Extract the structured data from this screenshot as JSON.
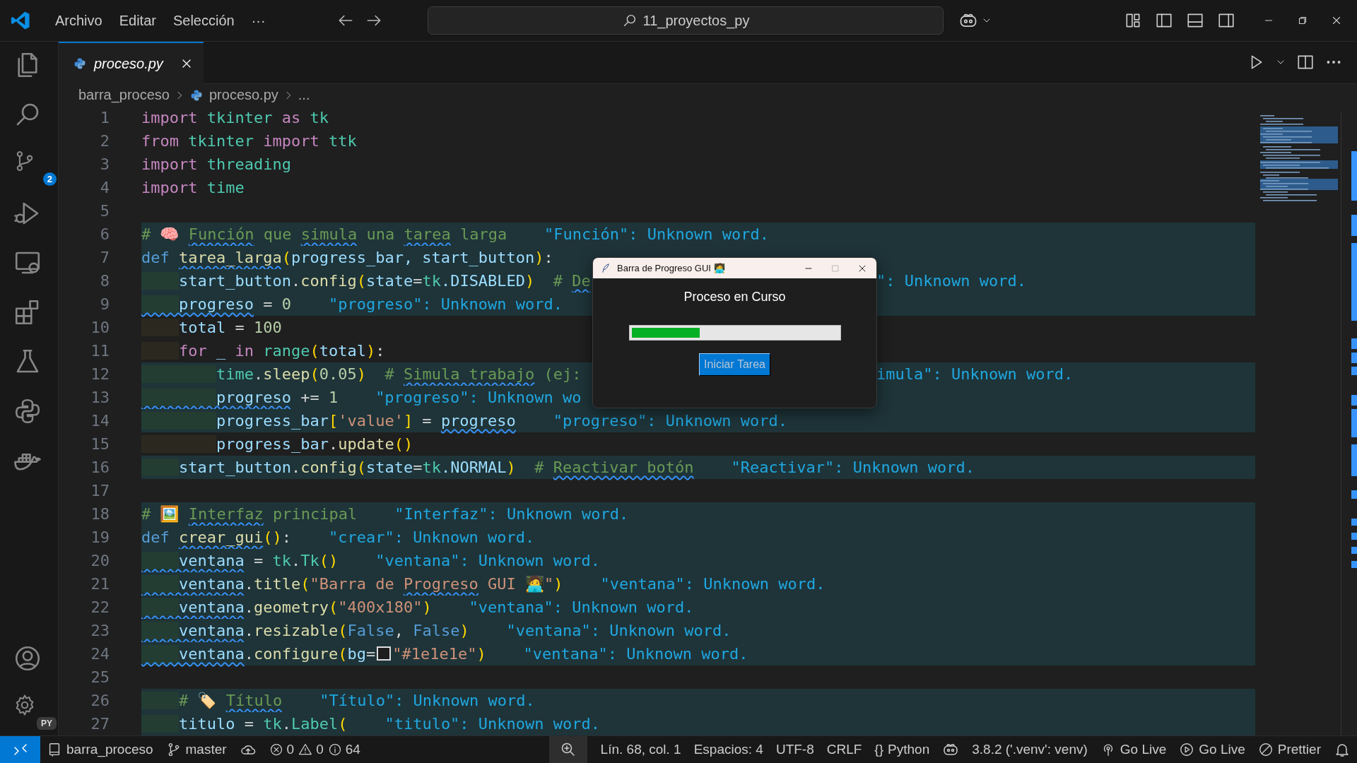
{
  "title_bar": {
    "menus": [
      "Archivo",
      "Editar",
      "Selección",
      "···"
    ],
    "search": "11_proyectos_py"
  },
  "activity_bar": {
    "items": [
      {
        "kind": "files"
      },
      {
        "kind": "search"
      },
      {
        "kind": "source-control",
        "badge": "2"
      },
      {
        "kind": "run-debug"
      },
      {
        "kind": "remote"
      },
      {
        "kind": "extensions"
      },
      {
        "kind": "testing"
      },
      {
        "kind": "python"
      },
      {
        "kind": "docker"
      }
    ],
    "bottom_items": [
      {
        "kind": "account"
      },
      {
        "kind": "settings",
        "badge": "PY"
      }
    ]
  },
  "editor": {
    "tabs": [
      {
        "label": "proceso.py",
        "selected": true
      }
    ],
    "breadcrumb": [
      {
        "kind": "folder",
        "text": "barra_proceso"
      },
      {
        "kind": "file",
        "text": "proceso.py"
      },
      {
        "kind": "more",
        "text": "..."
      }
    ],
    "lines": [
      {
        "number": "1",
        "highlighted": false,
        "code": [
          {
            "text": "import ",
            "kind": "kw",
            "misspelled": false
          },
          {
            "text": "tkinter ",
            "kind": "mod",
            "misspelled": false
          },
          {
            "text": "as ",
            "kind": "kw",
            "misspelled": false
          },
          {
            "text": "tk",
            "kind": "mod",
            "misspelled": false
          }
        ]
      },
      {
        "number": "2",
        "highlighted": false,
        "code": [
          {
            "text": "from ",
            "kind": "kw",
            "misspelled": false
          },
          {
            "text": "tkinter ",
            "kind": "mod",
            "misspelled": false
          },
          {
            "text": "import ",
            "kind": "kw",
            "misspelled": false
          },
          {
            "text": "ttk",
            "kind": "mod",
            "misspelled": false
          }
        ]
      },
      {
        "number": "3",
        "highlighted": false,
        "code": [
          {
            "text": "import ",
            "kind": "kw",
            "misspelled": false
          },
          {
            "text": "threading",
            "kind": "mod",
            "misspelled": false
          }
        ]
      },
      {
        "number": "4",
        "highlighted": false,
        "code": [
          {
            "text": "import ",
            "kind": "kw",
            "misspelled": false
          },
          {
            "text": "time",
            "kind": "mod",
            "misspelled": false
          }
        ]
      },
      {
        "number": "5",
        "highlighted": false
      },
      {
        "number": "6",
        "highlighted": true,
        "code": [
          {
            "text": "# 🧠 ",
            "kind": "cmt",
            "misspelled": false
          },
          {
            "text": "Función",
            "kind": "cmt",
            "misspelled": true
          },
          {
            "text": " que ",
            "kind": "cmt",
            "misspelled": false
          },
          {
            "text": "simula",
            "kind": "cmt",
            "misspelled": true
          },
          {
            "text": " una ",
            "kind": "cmt",
            "misspelled": false
          },
          {
            "text": "tarea",
            "kind": "cmt",
            "misspelled": true
          },
          {
            "text": " larga",
            "kind": "cmt",
            "misspelled": false
          }
        ],
        "diagnostic": "\"Función\": Unknown word."
      },
      {
        "number": "7",
        "highlighted": true,
        "code": [
          {
            "text": "def ",
            "kind": "kw2",
            "misspelled": false
          },
          {
            "text": "tarea_larga",
            "kind": "fn",
            "misspelled": true
          },
          {
            "text": "(",
            "kind": "br",
            "misspelled": false
          },
          {
            "text": "progress_bar, start_button",
            "kind": "var",
            "misspelled": false
          },
          {
            "text": ")",
            "kind": "br",
            "misspelled": false
          },
          {
            "text": ":",
            "kind": "p",
            "misspelled": false
          }
        ]
      },
      {
        "number": "8",
        "highlighted": true,
        "code": [
          {
            "text": "    start_button",
            "kind": "var",
            "misspelled": false
          },
          {
            "text": ".",
            "kind": "p",
            "misspelled": false
          },
          {
            "text": "config",
            "kind": "fn",
            "misspelled": false
          },
          {
            "text": "(",
            "kind": "br",
            "misspelled": false
          },
          {
            "text": "state",
            "kind": "var",
            "misspelled": false
          },
          {
            "text": "=",
            "kind": "p",
            "misspelled": false
          },
          {
            "text": "tk",
            "kind": "mod",
            "misspelled": false
          },
          {
            "text": ".DISABLED",
            "kind": "var",
            "misspelled": false
          },
          {
            "text": ")",
            "kind": "br",
            "misspelled": false
          },
          {
            "text": "  # ",
            "kind": "cmt",
            "misspelled": false
          },
          {
            "text": "De",
            "kind": "cmt",
            "misspelled": true
          }
        ],
        "right": "\": Unknown word."
      },
      {
        "number": "9",
        "highlighted": true,
        "code": [
          {
            "text": "    progreso",
            "kind": "var",
            "misspelled": true
          },
          {
            "text": " = ",
            "kind": "p",
            "misspelled": false
          },
          {
            "text": "0",
            "kind": "num",
            "misspelled": false
          }
        ],
        "diagnostic": "\"progreso\": Unknown word."
      },
      {
        "number": "10",
        "highlighted": false,
        "code": [
          {
            "text": "    total",
            "kind": "var",
            "misspelled": false
          },
          {
            "text": " = ",
            "kind": "p",
            "misspelled": false
          },
          {
            "text": "100",
            "kind": "num",
            "misspelled": false
          }
        ]
      },
      {
        "number": "11",
        "highlighted": false,
        "code": [
          {
            "text": "    for ",
            "kind": "kw",
            "misspelled": false
          },
          {
            "text": "_ ",
            "kind": "var",
            "misspelled": false
          },
          {
            "text": "in ",
            "kind": "kw",
            "misspelled": false
          },
          {
            "text": "range",
            "kind": "mod",
            "misspelled": false
          },
          {
            "text": "(",
            "kind": "br",
            "misspelled": false
          },
          {
            "text": "total",
            "kind": "var",
            "misspelled": false
          },
          {
            "text": ")",
            "kind": "br",
            "misspelled": false
          },
          {
            "text": ":",
            "kind": "p",
            "misspelled": false
          }
        ]
      },
      {
        "number": "12",
        "highlighted": true,
        "code": [
          {
            "text": "        time",
            "kind": "mod",
            "misspelled": false
          },
          {
            "text": ".",
            "kind": "p",
            "misspelled": false
          },
          {
            "text": "sleep",
            "kind": "fn",
            "misspelled": false
          },
          {
            "text": "(",
            "kind": "br",
            "misspelled": false
          },
          {
            "text": "0.05",
            "kind": "num",
            "misspelled": false
          },
          {
            "text": ")",
            "kind": "br",
            "misspelled": false
          },
          {
            "text": "  # ",
            "kind": "cmt",
            "misspelled": false
          },
          {
            "text": "Simula trabajo",
            "kind": "cmt",
            "misspelled": true
          },
          {
            "text": " (ej:",
            "kind": "cmt",
            "misspelled": false
          }
        ],
        "right": "imula\": Unknown word."
      },
      {
        "number": "13",
        "highlighted": true,
        "code": [
          {
            "text": "        progreso",
            "kind": "var",
            "misspelled": true
          },
          {
            "text": " += ",
            "kind": "p",
            "misspelled": false
          },
          {
            "text": "1",
            "kind": "num",
            "misspelled": false
          }
        ],
        "diagnostic": "\"progreso\": Unknown wo"
      },
      {
        "number": "14",
        "highlighted": true,
        "code": [
          {
            "text": "        progress_bar",
            "kind": "var",
            "misspelled": false
          },
          {
            "text": "[",
            "kind": "br",
            "misspelled": false
          },
          {
            "text": "'value'",
            "kind": "str",
            "misspelled": false
          },
          {
            "text": "]",
            "kind": "br",
            "misspelled": false
          },
          {
            "text": " = ",
            "kind": "p",
            "misspelled": false
          },
          {
            "text": "progreso",
            "kind": "var",
            "misspelled": true
          }
        ],
        "diagnostic": "\"progreso\": Unknown word."
      },
      {
        "number": "15",
        "highlighted": false,
        "code": [
          {
            "text": "        progress_bar",
            "kind": "var",
            "misspelled": false
          },
          {
            "text": ".",
            "kind": "p",
            "misspelled": false
          },
          {
            "text": "update",
            "kind": "fn",
            "misspelled": false
          },
          {
            "text": "()",
            "kind": "br",
            "misspelled": false
          }
        ]
      },
      {
        "number": "16",
        "highlighted": true,
        "code": [
          {
            "text": "    start_button",
            "kind": "var",
            "misspelled": false
          },
          {
            "text": ".",
            "kind": "p",
            "misspelled": false
          },
          {
            "text": "config",
            "kind": "fn",
            "misspelled": false
          },
          {
            "text": "(",
            "kind": "br",
            "misspelled": false
          },
          {
            "text": "state",
            "kind": "var",
            "misspelled": false
          },
          {
            "text": "=",
            "kind": "p",
            "misspelled": false
          },
          {
            "text": "tk",
            "kind": "mod",
            "misspelled": false
          },
          {
            "text": ".NORMAL",
            "kind": "var",
            "misspelled": false
          },
          {
            "text": ")",
            "kind": "br",
            "misspelled": false
          },
          {
            "text": "  # ",
            "kind": "cmt",
            "misspelled": false
          },
          {
            "text": "Reactivar botón",
            "kind": "cmt",
            "misspelled": true
          }
        ],
        "diagnostic": "\"Reactivar\": Unknown word."
      },
      {
        "number": "17",
        "highlighted": false
      },
      {
        "number": "18",
        "highlighted": true,
        "code": [
          {
            "text": "# 🖼️ ",
            "kind": "cmt",
            "misspelled": false
          },
          {
            "text": "Interfaz",
            "kind": "cmt",
            "misspelled": true
          },
          {
            "text": " principal",
            "kind": "cmt",
            "misspelled": false
          }
        ],
        "diagnostic": "\"Interfaz\": Unknown word."
      },
      {
        "number": "19",
        "highlighted": true,
        "code": [
          {
            "text": "def ",
            "kind": "kw2",
            "misspelled": false
          },
          {
            "text": "crear_gui",
            "kind": "fn",
            "misspelled": true
          },
          {
            "text": "()",
            "kind": "br",
            "misspelled": false
          },
          {
            "text": ":",
            "kind": "p",
            "misspelled": false
          }
        ],
        "diagnostic": "\"crear\": Unknown word."
      },
      {
        "number": "20",
        "highlighted": true,
        "code": [
          {
            "text": "    ventana",
            "kind": "var",
            "misspelled": true
          },
          {
            "text": " = ",
            "kind": "p",
            "misspelled": false
          },
          {
            "text": "tk",
            "kind": "mod",
            "misspelled": false
          },
          {
            "text": ".",
            "kind": "p",
            "misspelled": false
          },
          {
            "text": "Tk",
            "kind": "mod",
            "misspelled": false
          },
          {
            "text": "()",
            "kind": "br",
            "misspelled": false
          }
        ],
        "diagnostic": "\"ventana\": Unknown word."
      },
      {
        "number": "21",
        "highlighted": true,
        "code": [
          {
            "text": "    ventana",
            "kind": "var",
            "misspelled": true
          },
          {
            "text": ".",
            "kind": "p",
            "misspelled": false
          },
          {
            "text": "title",
            "kind": "fn",
            "misspelled": false
          },
          {
            "text": "(",
            "kind": "br",
            "misspelled": false
          },
          {
            "text": "\"Barra de ",
            "kind": "str",
            "misspelled": false
          },
          {
            "text": "Progreso",
            "kind": "str",
            "misspelled": true
          },
          {
            "text": " GUI 🧑‍💻\"",
            "kind": "str",
            "misspelled": false
          },
          {
            "text": ")",
            "kind": "br",
            "misspelled": false
          }
        ],
        "diagnostic": "\"ventana\": Unknown word."
      },
      {
        "number": "22",
        "highlighted": true,
        "code": [
          {
            "text": "    ventana",
            "kind": "var",
            "misspelled": true
          },
          {
            "text": ".",
            "kind": "p",
            "misspelled": false
          },
          {
            "text": "geometry",
            "kind": "fn",
            "misspelled": false
          },
          {
            "text": "(",
            "kind": "br",
            "misspelled": false
          },
          {
            "text": "\"400x180\"",
            "kind": "str",
            "misspelled": false
          },
          {
            "text": ")",
            "kind": "br",
            "misspelled": false
          }
        ],
        "diagnostic": "\"ventana\": Unknown word."
      },
      {
        "number": "23",
        "highlighted": true,
        "code": [
          {
            "text": "    ventana",
            "kind": "var",
            "misspelled": true
          },
          {
            "text": ".",
            "kind": "p",
            "misspelled": false
          },
          {
            "text": "resizable",
            "kind": "fn",
            "misspelled": false
          },
          {
            "text": "(",
            "kind": "br",
            "misspelled": false
          },
          {
            "text": "False",
            "kind": "kw2",
            "misspelled": false
          },
          {
            "text": ", ",
            "kind": "p",
            "misspelled": false
          },
          {
            "text": "False",
            "kind": "kw2",
            "misspelled": false
          },
          {
            "text": ")",
            "kind": "br",
            "misspelled": false
          }
        ],
        "diagnostic": "\"ventana\": Unknown word."
      },
      {
        "number": "24",
        "highlighted": true,
        "code": [
          {
            "text": "    ventana",
            "kind": "var",
            "misspelled": true
          },
          {
            "text": ".",
            "kind": "p",
            "misspelled": false
          },
          {
            "text": "configure",
            "kind": "fn",
            "misspelled": false
          },
          {
            "text": "(",
            "kind": "br",
            "misspelled": false
          },
          {
            "text": "bg",
            "kind": "var",
            "misspelled": false
          },
          {
            "text": "=",
            "kind": "p",
            "misspelled": false
          },
          {
            "kind": "swatch",
            "color": "#1e1e1e"
          },
          {
            "text": "\"#1e1e1e\"",
            "kind": "str",
            "misspelled": false
          },
          {
            "text": ")",
            "kind": "br",
            "misspelled": false
          }
        ],
        "diagnostic": "\"ventana\": Unknown word."
      },
      {
        "number": "25",
        "highlighted": false
      },
      {
        "number": "26",
        "highlighted": true,
        "code": [
          {
            "text": "    # 🏷️ ",
            "kind": "cmt",
            "misspelled": false
          },
          {
            "text": "Título",
            "kind": "cmt",
            "misspelled": true
          }
        ],
        "diagnostic": "\"Título\": Unknown word."
      },
      {
        "number": "27",
        "highlighted": true,
        "code": [
          {
            "text": "    titulo",
            "kind": "var",
            "misspelled": false
          },
          {
            "text": " = ",
            "kind": "p",
            "misspelled": false
          },
          {
            "text": "tk",
            "kind": "mod",
            "misspelled": false
          },
          {
            "text": ".",
            "kind": "p",
            "misspelled": false
          },
          {
            "text": "Label",
            "kind": "mod",
            "misspelled": false
          },
          {
            "text": "(",
            "kind": "br",
            "misspelled": false
          }
        ],
        "diagnostic": "\"titulo\": Unknown word."
      }
    ]
  },
  "dialog": {
    "title": "Barra de Progreso GUI 🧑‍💻",
    "heading": "Proceso en Curso",
    "progress": {
      "level": 0.33
    },
    "button": {
      "label": "Iniciar Tarea",
      "disabled": true
    }
  },
  "status_bar": {
    "left": [
      {
        "kind": "remote"
      },
      {
        "kind": "folder",
        "text": "barra_proceso"
      },
      {
        "kind": "branch",
        "text": "master"
      },
      {
        "kind": "sync"
      },
      {
        "kind": "problems",
        "errors": "0",
        "warnings": "0",
        "infos": "64"
      }
    ],
    "right": [
      {
        "kind": "zoom"
      },
      {
        "kind": "text",
        "text": "Lín. 68, col. 1"
      },
      {
        "kind": "text",
        "text": "Espacios: 4"
      },
      {
        "kind": "text",
        "text": "UTF-8"
      },
      {
        "kind": "text",
        "text": "CRLF"
      },
      {
        "kind": "language",
        "glyph": "{}",
        "text": "Python"
      },
      {
        "kind": "copilot"
      },
      {
        "kind": "text",
        "text": "3.8.2 ('.venv': venv)"
      },
      {
        "kind": "broadcast",
        "text": "Go Live"
      },
      {
        "kind": "play",
        "text": "Go Live"
      },
      {
        "kind": "prettier",
        "text": "Prettier"
      },
      {
        "kind": "bell"
      }
    ]
  }
}
